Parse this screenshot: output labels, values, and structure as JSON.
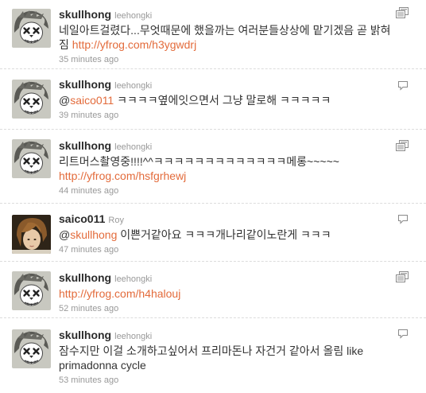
{
  "tweets": [
    {
      "screen_name": "skullhong",
      "real_name": "leehongki",
      "avatar": "skull-avatar",
      "text_before": "네일아트걸렸다...무엇때문에 했을까는 여러분들상상에 맡기겠음 곧 밝혀짐 ",
      "link": "http://yfrog.com/h3ygwdrj",
      "text_after": "",
      "time": "35 minutes ago",
      "corner_icon": "retweet-icon"
    },
    {
      "screen_name": "skullhong",
      "real_name": "leehongki",
      "avatar": "skull-avatar",
      "text_before": "@",
      "link": "saico011",
      "text_after": " ㅋㅋㅋㅋ옆에잇으면서 그냥 말로해 ㅋㅋㅋㅋㅋ",
      "time": "39 minutes ago",
      "corner_icon": "reply-icon"
    },
    {
      "screen_name": "skullhong",
      "real_name": "leehongki",
      "avatar": "skull-avatar",
      "text_before": "리트머스촬영중!!!!^^ㅋㅋㅋㅋㅋㅋㅋㅋㅋㅋㅋㅋㅋ메롱~~~~~ ",
      "link": "http://yfrog.com/hsfgrhewj",
      "text_after": "",
      "time": "44 minutes ago",
      "corner_icon": "retweet-icon"
    },
    {
      "screen_name": "saico011",
      "real_name": "Roy",
      "avatar": "photo-avatar",
      "text_before": "@",
      "link": "skullhong",
      "text_after": " 이쁜거같아요 ㅋㅋㅋ개나리같이노란게 ㅋㅋㅋ",
      "time": "47 minutes ago",
      "corner_icon": "reply-icon"
    },
    {
      "screen_name": "skullhong",
      "real_name": "leehongki",
      "avatar": "skull-avatar",
      "text_before": "",
      "link": "http://yfrog.com/h4halouj",
      "text_after": "",
      "time": "52 minutes ago",
      "corner_icon": "retweet-icon"
    },
    {
      "screen_name": "skullhong",
      "real_name": "leehongki",
      "avatar": "skull-avatar",
      "text_before": "잠수지만 이걸 소개하고싶어서 프리마돈나 자건거 같아서 올림 like primadonna cycle",
      "link": "",
      "text_after": "",
      "time": "53 minutes ago",
      "corner_icon": "reply-icon"
    }
  ]
}
